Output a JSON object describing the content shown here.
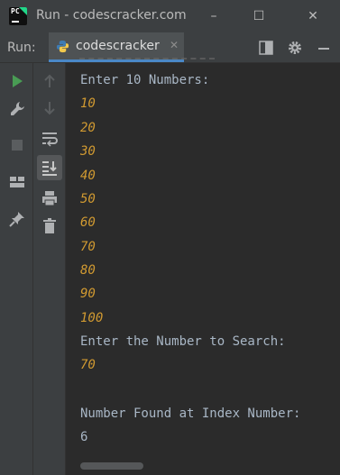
{
  "window": {
    "title": "Run - codescracker.com",
    "logo_text": "PC",
    "controls": [
      "–",
      "☐",
      "✕"
    ]
  },
  "run_panel": {
    "label": "Run:",
    "tab": {
      "label": "codescracker",
      "close": "✕",
      "icon": "python-icon"
    },
    "header_icons": [
      "layout-icon",
      "gear-icon",
      "minimize-icon"
    ],
    "left_toolbar": [
      "run-icon",
      "wrench-icon",
      "stop-icon",
      "layout-panels-icon",
      "pin-icon"
    ],
    "right_toolbar": [
      "scroll-up-icon",
      "scroll-down-icon",
      "soft-wrap-icon",
      "scroll-to-end-icon",
      "print-icon",
      "delete-icon"
    ]
  },
  "console": {
    "lines": [
      {
        "text": "Enter 10 Numbers:",
        "kind": "output"
      },
      {
        "text": "10",
        "kind": "input"
      },
      {
        "text": "20",
        "kind": "input"
      },
      {
        "text": "30",
        "kind": "input"
      },
      {
        "text": "40",
        "kind": "input"
      },
      {
        "text": "50",
        "kind": "input"
      },
      {
        "text": "60",
        "kind": "input"
      },
      {
        "text": "70",
        "kind": "input"
      },
      {
        "text": "80",
        "kind": "input"
      },
      {
        "text": "90",
        "kind": "input"
      },
      {
        "text": "100",
        "kind": "input"
      },
      {
        "text": "Enter the Number to Search:",
        "kind": "output"
      },
      {
        "text": "70",
        "kind": "input"
      },
      {
        "text": "",
        "kind": "output"
      },
      {
        "text": "Number Found at Index Number:",
        "kind": "output"
      },
      {
        "text": "6",
        "kind": "output"
      }
    ]
  },
  "colors": {
    "output_text": "#a9b7c6",
    "input_text": "#d19a31",
    "accent": "#4a88c7",
    "run_green": "#499c54"
  }
}
